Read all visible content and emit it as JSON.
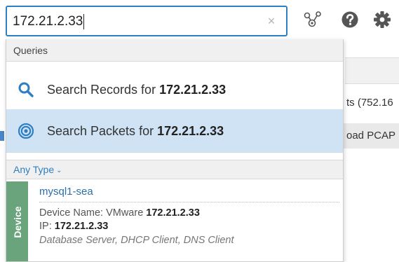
{
  "search": {
    "value": "172.21.2.33",
    "clear_label": "×"
  },
  "toolbar": {
    "network_icon": "network-map-icon",
    "help_icon": "help-icon",
    "settings_icon": "gear-icon"
  },
  "background": {
    "text_1": "ts (752.16",
    "text_2": "oad PCAP"
  },
  "dropdown": {
    "section_title": "Queries",
    "queries": [
      {
        "icon": "search-icon",
        "prefix": "Search Records for ",
        "term": "172.21.2.33"
      },
      {
        "icon": "packets-icon",
        "prefix": "Search Packets for ",
        "term": "172.21.2.33"
      }
    ],
    "type_filter": {
      "label": "Any Type",
      "chevron": "⌄"
    },
    "result": {
      "category": "Device",
      "name": "mysql1-sea",
      "device_name_label": "Device Name: VMware ",
      "device_name_value": "172.21.2.33",
      "ip_label": "IP: ",
      "ip_value": "172.21.2.33",
      "roles": "Database Server, DHCP Client, DNS Client"
    }
  },
  "colors": {
    "accent": "#2d7fc1",
    "selected_row": "#cfe3f5",
    "device_tab": "#6aa47d",
    "header_bg": "#f0f0f0"
  }
}
